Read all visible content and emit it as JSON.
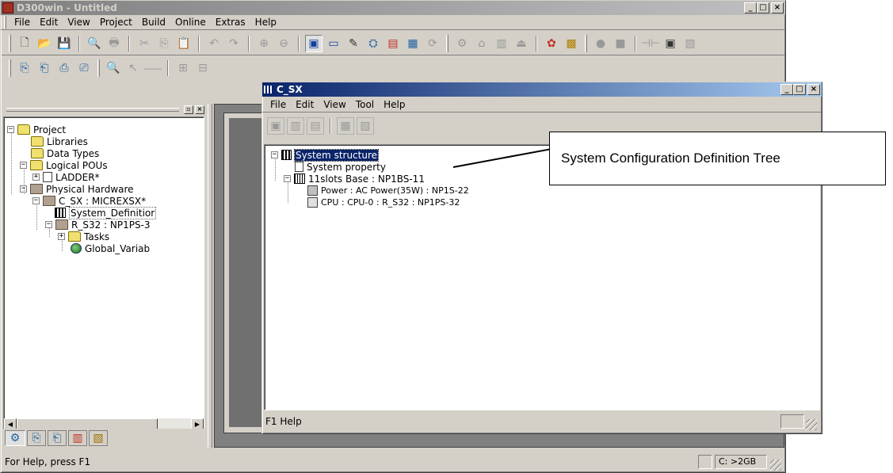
{
  "main_window": {
    "title": "D300win - Untitled",
    "menu": [
      "File",
      "Edit",
      "View",
      "Project",
      "Build",
      "Online",
      "Extras",
      "Help"
    ],
    "status_text": "For Help, press F1",
    "disk_status": "C: >2GB"
  },
  "project_tree": {
    "items": [
      {
        "label": "Project",
        "icon": "folder-open-icon",
        "expander": "−"
      },
      {
        "label": "Libraries",
        "icon": "folder-icon"
      },
      {
        "label": "Data Types",
        "icon": "folder-icon"
      },
      {
        "label": "Logical POUs",
        "icon": "folder-open-icon",
        "expander": "−"
      },
      {
        "label": "LADDER*",
        "icon": "pou-icon",
        "expander": "+"
      },
      {
        "label": "Physical Hardware",
        "icon": "hardware-folder-icon",
        "expander": "−"
      },
      {
        "label": "C_SX : MICREXSX*",
        "icon": "hardware-folder-icon",
        "expander": "−"
      },
      {
        "label": "System_Definitior",
        "icon": "system-definition-icon"
      },
      {
        "label": "R_S32 : NP1PS-3",
        "icon": "hardware-folder-icon",
        "expander": "−"
      },
      {
        "label": "Tasks",
        "icon": "folder-icon",
        "expander": "+"
      },
      {
        "label": "Global_Variab",
        "icon": "global-variables-icon"
      }
    ]
  },
  "child_window": {
    "title": "C_SX",
    "menu": [
      "File",
      "Edit",
      "View",
      "Tool",
      "Help"
    ],
    "status_text": "F1 Help",
    "tree": [
      {
        "label": "System structure",
        "expander": "−",
        "selected": true
      },
      {
        "label": "System property"
      },
      {
        "label": "11slots Base : NP1BS-11",
        "expander": "−"
      },
      {
        "label": "Power : AC Power(35W) : NP1S-22"
      },
      {
        "label": "CPU : CPU-0 : R_S32 : NP1PS-32"
      }
    ]
  },
  "callout": {
    "text": "System Configuration Definition Tree"
  }
}
